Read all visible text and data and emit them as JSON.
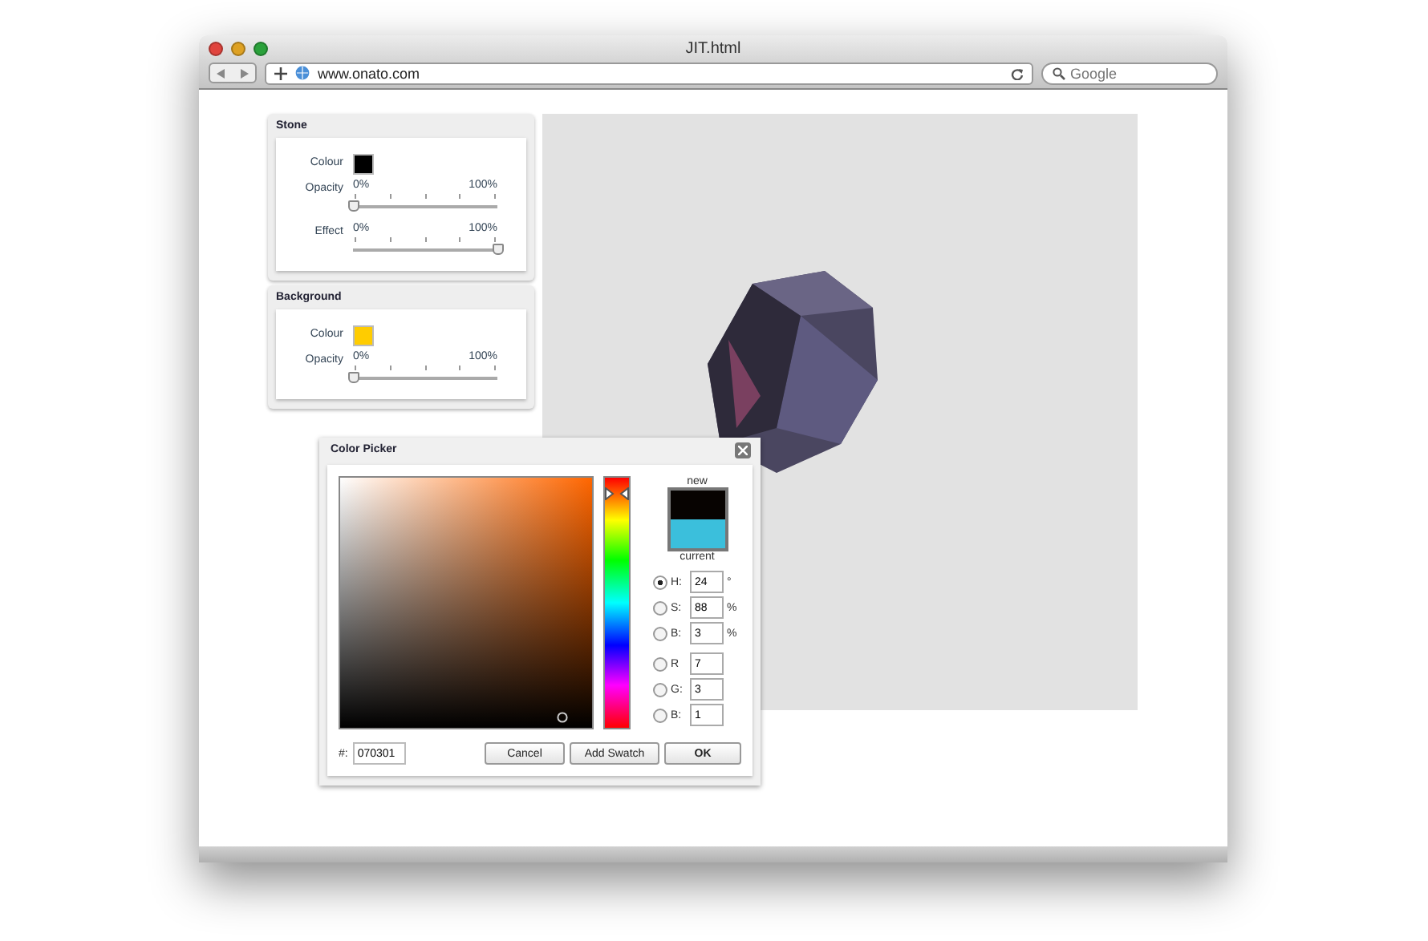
{
  "window": {
    "title": "JIT.html",
    "url": "www.onato.com",
    "search_placeholder": "Google"
  },
  "panels": [
    {
      "title": "Stone",
      "rows": [
        {
          "kind": "colour",
          "label": "Colour",
          "color": "#000000"
        },
        {
          "kind": "slider",
          "label": "Opacity",
          "min": "0%",
          "max": "100%",
          "level": 0
        },
        {
          "kind": "slider",
          "label": "Effect",
          "min": "0%",
          "max": "100%",
          "level": 1
        }
      ]
    },
    {
      "title": "Background",
      "rows": [
        {
          "kind": "colour",
          "label": "Colour",
          "color": "#ffcc00"
        },
        {
          "kind": "slider",
          "label": "Opacity",
          "min": "0%",
          "max": "100%",
          "level": 0
        }
      ]
    }
  ],
  "color_picker": {
    "title": "Color Picker",
    "swatches": [
      {
        "label": "new",
        "color": "#070301"
      },
      {
        "label": "current",
        "color": "#3bbfdc"
      }
    ],
    "fields": [
      {
        "label": "H:",
        "value": "24",
        "unit": "°",
        "selected": true
      },
      {
        "label": "S:",
        "value": "88",
        "unit": "%",
        "selected": false
      },
      {
        "label": "B:",
        "value": "3",
        "unit": "%",
        "selected": false
      },
      {
        "label": "R",
        "value": "7",
        "selected": false
      },
      {
        "label": "G:",
        "value": "3",
        "selected": false
      },
      {
        "label": "B:",
        "value": "1",
        "selected": false
      }
    ],
    "hex_label": "#:",
    "hex": "070301",
    "buttons": [
      "Cancel",
      "Add Swatch",
      "OK"
    ]
  }
}
